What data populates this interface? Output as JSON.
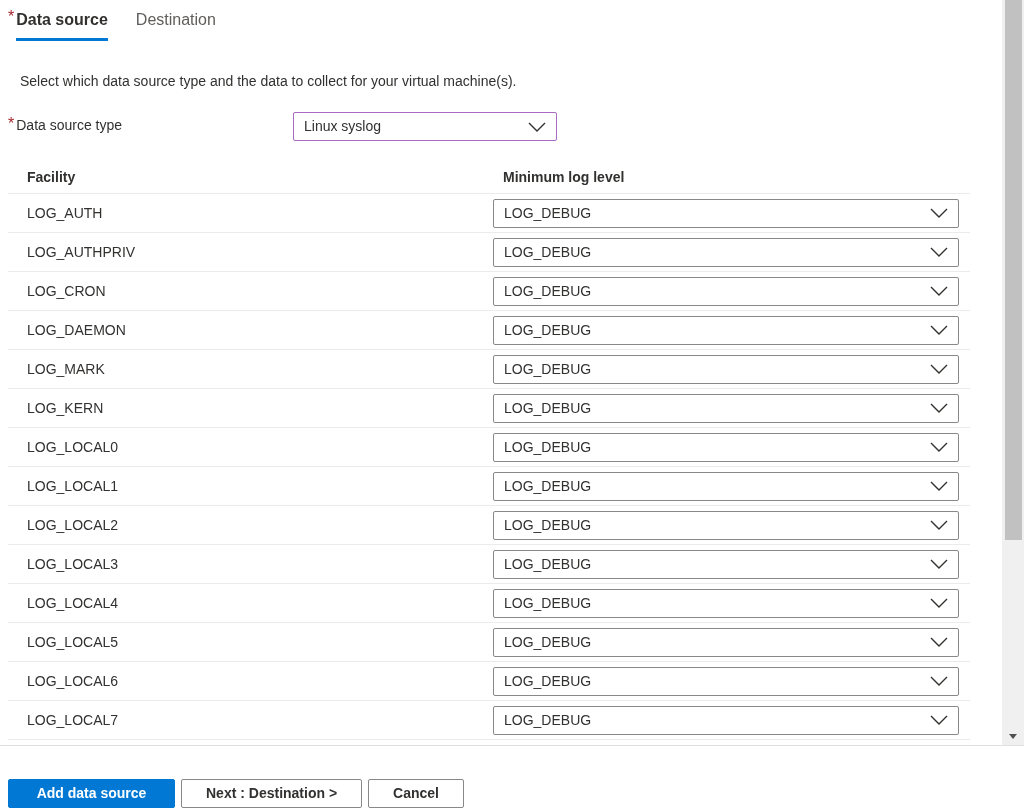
{
  "tabs": [
    {
      "label": "Data source",
      "selected": true,
      "required_mark": "*"
    },
    {
      "label": "Destination",
      "selected": false
    }
  ],
  "description": "Select which data source type and the data to collect for your virtual machine(s).",
  "data_source_type": {
    "label": "Data source type",
    "required_mark": "*",
    "value": "Linux syslog"
  },
  "table": {
    "columns": [
      "Facility",
      "Minimum log level"
    ],
    "rows": [
      {
        "facility": "LOG_AUTH",
        "level": "LOG_DEBUG"
      },
      {
        "facility": "LOG_AUTHPRIV",
        "level": "LOG_DEBUG"
      },
      {
        "facility": "LOG_CRON",
        "level": "LOG_DEBUG"
      },
      {
        "facility": "LOG_DAEMON",
        "level": "LOG_DEBUG"
      },
      {
        "facility": "LOG_MARK",
        "level": "LOG_DEBUG"
      },
      {
        "facility": "LOG_KERN",
        "level": "LOG_DEBUG"
      },
      {
        "facility": "LOG_LOCAL0",
        "level": "LOG_DEBUG"
      },
      {
        "facility": "LOG_LOCAL1",
        "level": "LOG_DEBUG"
      },
      {
        "facility": "LOG_LOCAL2",
        "level": "LOG_DEBUG"
      },
      {
        "facility": "LOG_LOCAL3",
        "level": "LOG_DEBUG"
      },
      {
        "facility": "LOG_LOCAL4",
        "level": "LOG_DEBUG"
      },
      {
        "facility": "LOG_LOCAL5",
        "level": "LOG_DEBUG"
      },
      {
        "facility": "LOG_LOCAL6",
        "level": "LOG_DEBUG"
      },
      {
        "facility": "LOG_LOCAL7",
        "level": "LOG_DEBUG"
      }
    ]
  },
  "buttons": [
    {
      "label": "Add data source",
      "kind": "primary"
    },
    {
      "label": "Next : Destination >",
      "kind": "secondary"
    },
    {
      "label": "Cancel",
      "kind": "secondary"
    }
  ]
}
